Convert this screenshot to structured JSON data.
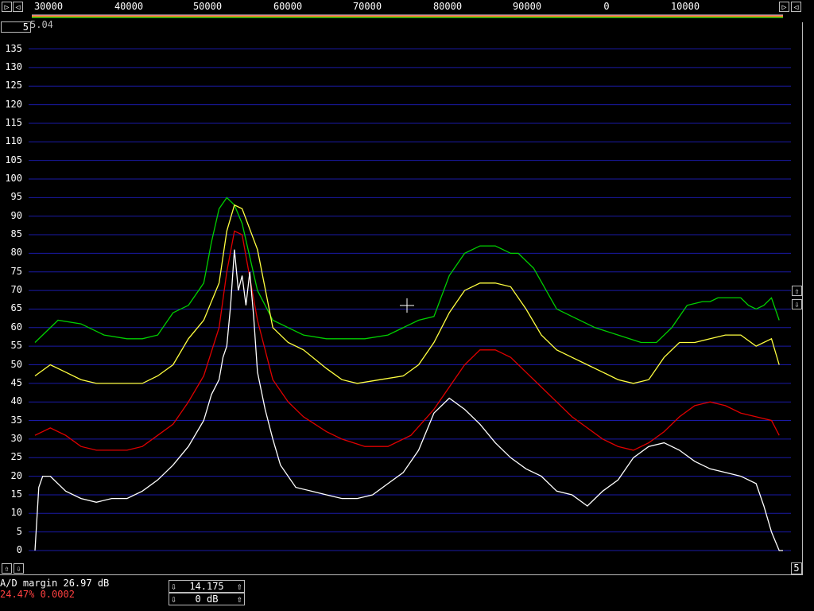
{
  "top_axis": {
    "labels": [
      "30000",
      "40000",
      "50000",
      "60000",
      "70000",
      "80000",
      "90000",
      "0",
      "10000"
    ]
  },
  "top_readout": "5.04",
  "top_readout_box": "5",
  "right_scroll_box": "5",
  "status": {
    "ad_margin": "A/D margin 26.97 dB",
    "load": "24.47% 0.0002",
    "load_color": "#ff4040"
  },
  "controls": {
    "frequency": "14.175",
    "gain": "0 dB"
  },
  "icons": {
    "left": "arrow-left-icon",
    "right": "arrow-right-icon",
    "up": "arrow-up-icon",
    "down": "arrow-down-icon"
  },
  "chart_data": {
    "type": "line",
    "title": "",
    "xlabel": "",
    "ylabel": "",
    "ylim": [
      0,
      140
    ],
    "yticks": [
      0,
      5,
      10,
      15,
      20,
      25,
      30,
      35,
      40,
      45,
      50,
      55,
      60,
      65,
      70,
      75,
      80,
      85,
      90,
      95,
      100,
      105,
      110,
      115,
      120,
      125,
      130,
      135
    ],
    "grid": true,
    "series": [
      {
        "color": "#00d000",
        "x": [
          0,
          30,
          60,
          90,
          120,
          140,
          160,
          180,
          200,
          220,
          230,
          240,
          250,
          260,
          270,
          290,
          310,
          330,
          350,
          380,
          400,
          430,
          460,
          500,
          520,
          540,
          560,
          580,
          600,
          610,
          620,
          630,
          650,
          680,
          700,
          730,
          760,
          790,
          810,
          830,
          850,
          870,
          880,
          890,
          900,
          920,
          930,
          940,
          950,
          960,
          970
        ],
        "y": [
          56,
          62,
          61,
          58,
          57,
          57,
          58,
          64,
          66,
          72,
          83,
          92,
          95,
          93,
          88,
          70,
          62,
          60,
          58,
          57,
          57,
          57,
          58,
          62,
          63,
          74,
          80,
          82,
          82,
          81,
          80,
          80,
          76,
          65,
          63,
          60,
          58,
          56,
          56,
          60,
          66,
          67,
          67,
          68,
          68,
          68,
          66,
          65,
          66,
          68,
          62
        ]
      },
      {
        "color": "#ffff40",
        "x": [
          0,
          20,
          40,
          60,
          80,
          100,
          120,
          140,
          160,
          180,
          200,
          220,
          240,
          250,
          260,
          270,
          290,
          310,
          330,
          350,
          380,
          400,
          420,
          450,
          480,
          500,
          520,
          540,
          560,
          580,
          600,
          620,
          640,
          660,
          680,
          700,
          720,
          740,
          760,
          780,
          800,
          820,
          840,
          860,
          880,
          900,
          920,
          940,
          960,
          970
        ],
        "y": [
          47,
          50,
          48,
          46,
          45,
          45,
          45,
          45,
          47,
          50,
          57,
          62,
          72,
          86,
          93,
          92,
          81,
          60,
          56,
          54,
          49,
          46,
          45,
          46,
          47,
          50,
          56,
          64,
          70,
          72,
          72,
          71,
          65,
          58,
          54,
          52,
          50,
          48,
          46,
          45,
          46,
          52,
          56,
          56,
          57,
          58,
          58,
          55,
          57,
          50
        ]
      },
      {
        "color": "#e00000",
        "x": [
          0,
          20,
          40,
          60,
          80,
          100,
          120,
          140,
          160,
          180,
          200,
          220,
          240,
          250,
          260,
          270,
          290,
          310,
          330,
          350,
          380,
          400,
          430,
          460,
          490,
          520,
          540,
          560,
          580,
          600,
          620,
          640,
          660,
          680,
          700,
          720,
          740,
          760,
          780,
          800,
          820,
          840,
          860,
          880,
          900,
          920,
          940,
          960,
          970
        ],
        "y": [
          31,
          33,
          31,
          28,
          27,
          27,
          27,
          28,
          31,
          34,
          40,
          47,
          60,
          75,
          86,
          85,
          62,
          46,
          40,
          36,
          32,
          30,
          28,
          28,
          31,
          38,
          44,
          50,
          54,
          54,
          52,
          48,
          44,
          40,
          36,
          33,
          30,
          28,
          27,
          29,
          32,
          36,
          39,
          40,
          39,
          37,
          36,
          35,
          31
        ]
      },
      {
        "color": "#ffffff",
        "x": [
          0,
          5,
          10,
          20,
          40,
          60,
          80,
          100,
          120,
          140,
          160,
          180,
          200,
          220,
          230,
          240,
          245,
          250,
          255,
          260,
          265,
          270,
          275,
          280,
          285,
          290,
          300,
          310,
          320,
          340,
          360,
          380,
          400,
          420,
          440,
          460,
          480,
          500,
          520,
          540,
          560,
          580,
          600,
          620,
          640,
          660,
          680,
          700,
          720,
          740,
          760,
          780,
          800,
          820,
          840,
          860,
          880,
          900,
          920,
          940,
          950,
          960,
          970,
          975
        ],
        "y": [
          0,
          17,
          20,
          20,
          16,
          14,
          13,
          14,
          14,
          16,
          19,
          23,
          28,
          35,
          42,
          46,
          52,
          55,
          66,
          81,
          70,
          74,
          66,
          75,
          63,
          48,
          38,
          30,
          23,
          17,
          16,
          15,
          14,
          14,
          15,
          18,
          21,
          27,
          37,
          41,
          38,
          34,
          29,
          25,
          22,
          20,
          16,
          15,
          12,
          16,
          19,
          25,
          28,
          29,
          27,
          24,
          22,
          21,
          20,
          18,
          12,
          5,
          0,
          0
        ]
      }
    ]
  }
}
